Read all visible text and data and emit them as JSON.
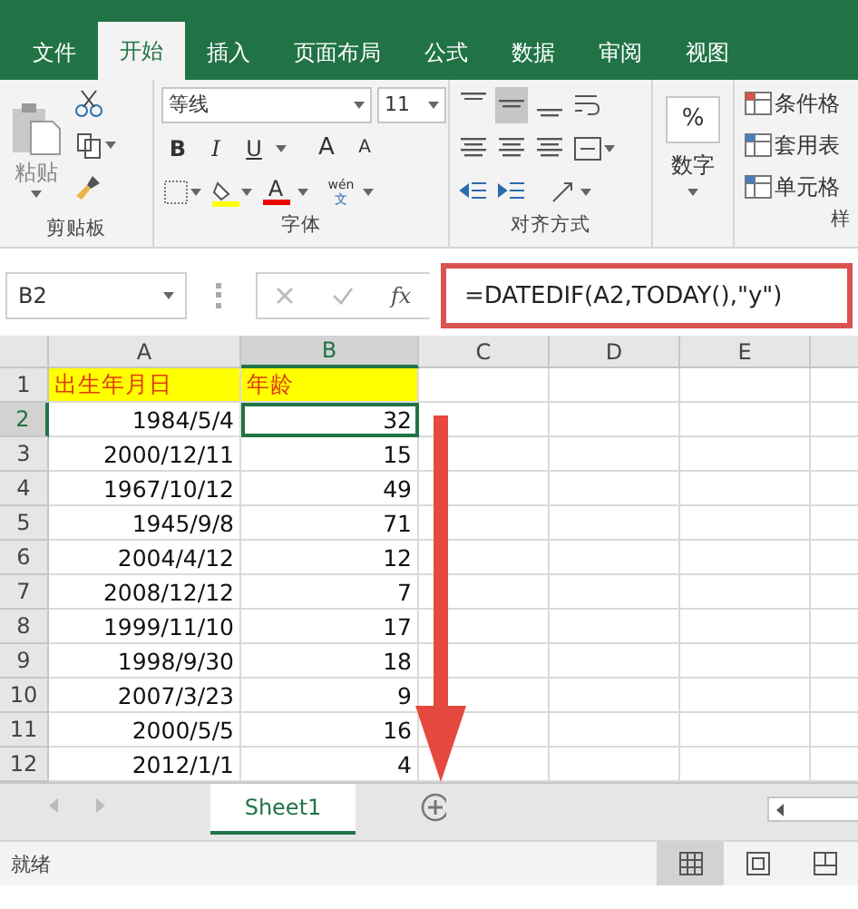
{
  "tabs": [
    {
      "label": "文件",
      "selected": false
    },
    {
      "label": "开始",
      "selected": true
    },
    {
      "label": "插入",
      "selected": false
    },
    {
      "label": "页面布局",
      "selected": false
    },
    {
      "label": "公式",
      "selected": false
    },
    {
      "label": "数据",
      "selected": false
    },
    {
      "label": "审阅",
      "selected": false
    },
    {
      "label": "视图",
      "selected": false
    }
  ],
  "ribbon": {
    "clipboard": {
      "paste": "粘贴",
      "label": "剪贴板"
    },
    "font": {
      "name": "等线",
      "size": "11",
      "bold": "B",
      "italic": "I",
      "underline": "U",
      "grow": "A",
      "shrink": "A",
      "color_letter": "A",
      "phonetic_top": "wén",
      "phonetic_bottom": "文",
      "label": "字体"
    },
    "alignment": {
      "vertical": [
        {
          "kind": "top",
          "selected": false
        },
        {
          "kind": "middle",
          "selected": true
        },
        {
          "kind": "bottom",
          "selected": false
        }
      ],
      "label": "对齐方式"
    },
    "number": {
      "symbol": "%",
      "label": "数字"
    },
    "styles": {
      "items": [
        "条件格",
        "套用表",
        "单元格"
      ],
      "label": "样"
    }
  },
  "formula_bar": {
    "name_box": "B2",
    "fx": "fx",
    "formula": "=DATEDIF(A2,TODAY(),\"y\")"
  },
  "columns": [
    {
      "label": "A",
      "selected": false
    },
    {
      "label": "B",
      "selected": true
    },
    {
      "label": "C",
      "selected": false
    },
    {
      "label": "D",
      "selected": false
    },
    {
      "label": "E",
      "selected": false
    }
  ],
  "rows": [
    {
      "number": "1",
      "kind": "heading",
      "selected": false,
      "cells": [
        "出生年月日",
        "年龄"
      ]
    },
    {
      "number": "2",
      "kind": "data",
      "selected": true,
      "cells": [
        "1984/5/4",
        "32"
      ]
    },
    {
      "number": "3",
      "kind": "data",
      "selected": false,
      "cells": [
        "2000/12/11",
        "15"
      ]
    },
    {
      "number": "4",
      "kind": "data",
      "selected": false,
      "cells": [
        "1967/10/12",
        "49"
      ]
    },
    {
      "number": "5",
      "kind": "data",
      "selected": false,
      "cells": [
        "1945/9/8",
        "71"
      ]
    },
    {
      "number": "6",
      "kind": "data",
      "selected": false,
      "cells": [
        "2004/4/12",
        "12"
      ]
    },
    {
      "number": "7",
      "kind": "data",
      "selected": false,
      "cells": [
        "2008/12/12",
        "7"
      ]
    },
    {
      "number": "8",
      "kind": "data",
      "selected": false,
      "cells": [
        "1999/11/10",
        "17"
      ]
    },
    {
      "number": "9",
      "kind": "data",
      "selected": false,
      "cells": [
        "1998/9/30",
        "18"
      ]
    },
    {
      "number": "10",
      "kind": "data",
      "selected": false,
      "cells": [
        "2007/3/23",
        "9"
      ]
    },
    {
      "number": "11",
      "kind": "data",
      "selected": false,
      "cells": [
        "2000/5/5",
        "16"
      ]
    },
    {
      "number": "12",
      "kind": "data",
      "selected": false,
      "cells": [
        "2012/1/1",
        "4"
      ]
    }
  ],
  "sheets": [
    {
      "label": "Sheet1",
      "selected": true
    }
  ],
  "status_bar": {
    "text": "就绪",
    "views": [
      {
        "kind": "normal",
        "selected": true
      },
      {
        "kind": "page_layout",
        "selected": false
      },
      {
        "kind": "page_break",
        "selected": false
      }
    ]
  }
}
